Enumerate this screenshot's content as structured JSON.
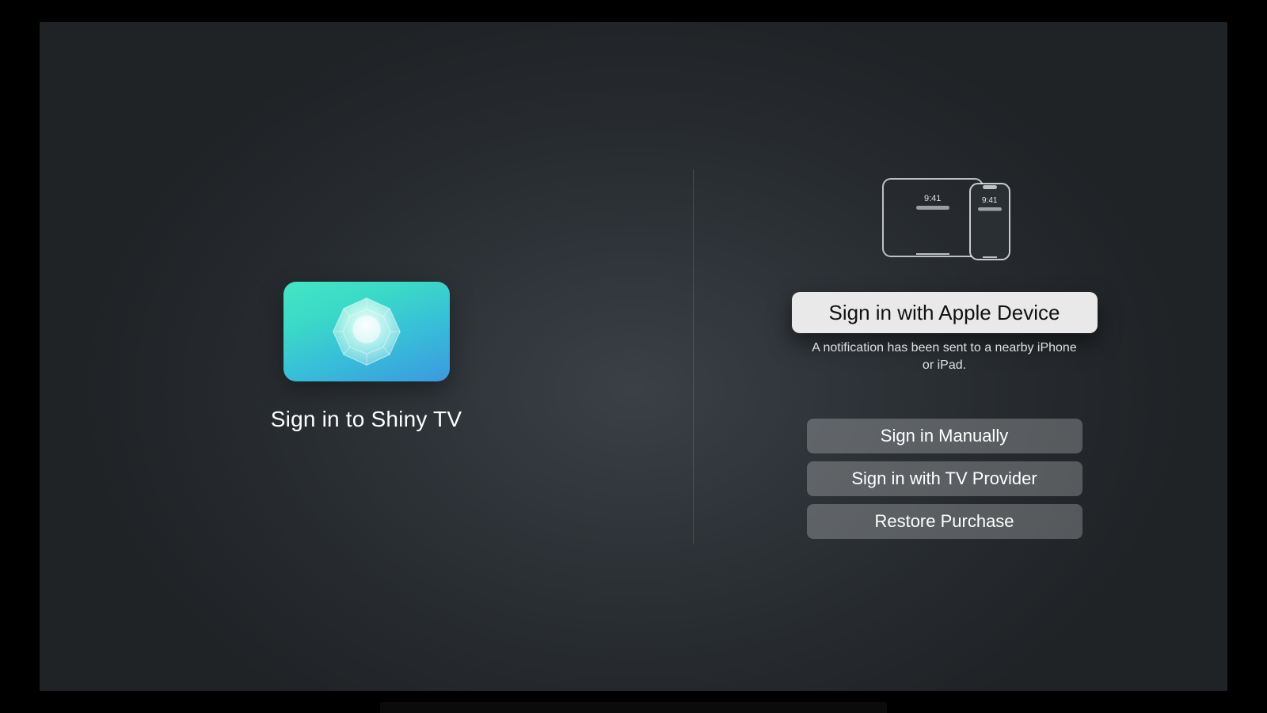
{
  "app": {
    "title": "Sign in to Shiny TV",
    "icon": "gem-icon"
  },
  "devices": {
    "ipad_time": "9:41",
    "iphone_time": "9:41"
  },
  "actions": {
    "primary": {
      "label": "Sign in with Apple Device",
      "helper": "A notification has been sent to a nearby iPhone or iPad."
    },
    "secondary": [
      {
        "label": "Sign in Manually"
      },
      {
        "label": "Sign in with TV Provider"
      },
      {
        "label": "Restore Purchase"
      }
    ]
  }
}
